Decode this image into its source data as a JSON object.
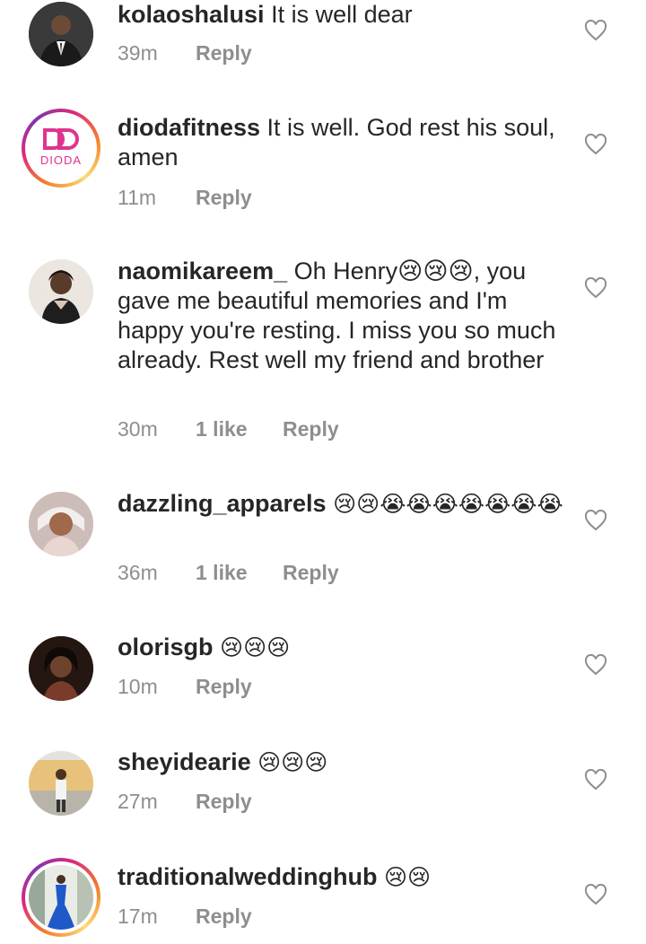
{
  "comments": [
    {
      "username": "kolaoshalusi",
      "text": "It is well dear",
      "emoji": "",
      "time": "39m",
      "likes": "",
      "reply_label": "Reply"
    },
    {
      "username": "diodafitness",
      "text": "It is well. God rest his soul, amen",
      "emoji": "",
      "time": "11m",
      "likes": "",
      "reply_label": "Reply",
      "avatar_logo": "DIODA"
    },
    {
      "username": "naomikareem_",
      "text": "Oh Henry😢😢😢, you gave me beautiful memories and I'm happy you're resting. I miss you so much already. Rest well my friend and brother",
      "emoji": "",
      "time": "30m",
      "likes": "1 like",
      "reply_label": "Reply"
    },
    {
      "username": "dazzling_apparels",
      "text": "",
      "emoji": "😢😢😭😭😭😭😭😭😭",
      "time": "36m",
      "likes": "1 like",
      "reply_label": "Reply"
    },
    {
      "username": "olorisgb",
      "text": "",
      "emoji": "😢😢😢",
      "time": "10m",
      "likes": "",
      "reply_label": "Reply"
    },
    {
      "username": "sheyidearie",
      "text": "",
      "emoji": "😢😢😢",
      "time": "27m",
      "likes": "",
      "reply_label": "Reply"
    },
    {
      "username": "traditionalweddinghub",
      "text": "",
      "emoji": "😢😢",
      "time": "17m",
      "likes": "",
      "reply_label": "Reply"
    }
  ],
  "icons": {
    "like": "heart-outline-icon"
  },
  "colors": {
    "text": "#262626",
    "meta": "#8e8e8e",
    "dioda_pink": "#e0338f"
  }
}
